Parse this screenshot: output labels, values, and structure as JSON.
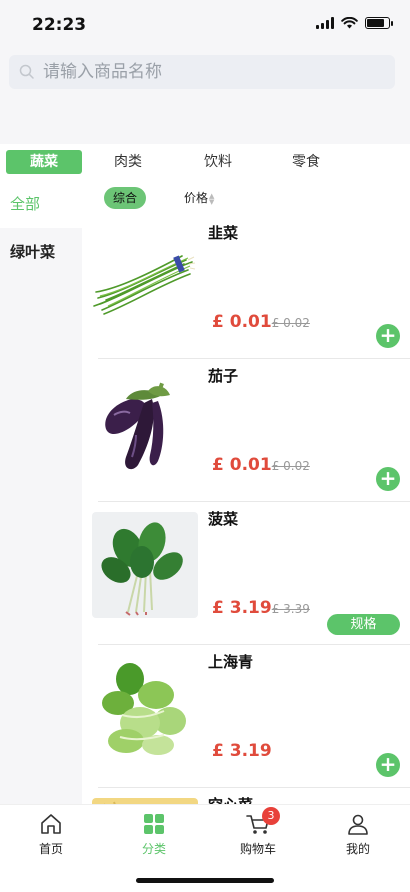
{
  "status_bar": {
    "time": "22:23",
    "battery_level": 0.8
  },
  "search": {
    "placeholder": "请输入商品名称",
    "value": ""
  },
  "top_categories": [
    {
      "label": "蔬菜",
      "active": true
    },
    {
      "label": "肉类",
      "active": false
    },
    {
      "label": "饮料",
      "active": false
    },
    {
      "label": "零食",
      "active": false
    }
  ],
  "sidebar": {
    "items": [
      {
        "label": "全部",
        "active": true
      },
      {
        "label": "绿叶菜",
        "active": false
      }
    ]
  },
  "sort": {
    "composite_label": "综合",
    "price_label": "价格"
  },
  "products": [
    {
      "name": "韭菜",
      "price": "£ 0.01",
      "old_price": "£ 0.02",
      "action": "add",
      "image": "chives"
    },
    {
      "name": "茄子",
      "price": "£ 0.01",
      "old_price": "£ 0.02",
      "action": "add",
      "image": "eggplant"
    },
    {
      "name": "菠菜",
      "price": "£ 3.19",
      "old_price": "£ 3.39",
      "action": "spec",
      "action_label": "规格",
      "image": "spinach"
    },
    {
      "name": "上海青",
      "price": "£ 3.19",
      "old_price": "",
      "action": "add",
      "image": "bok-choy"
    },
    {
      "name": "空心菜",
      "price": "",
      "old_price": "",
      "action": "",
      "image": "water-spinach"
    }
  ],
  "tab_bar": {
    "tabs": [
      {
        "label": "首页",
        "icon": "home-icon",
        "active": false
      },
      {
        "label": "分类",
        "icon": "category-icon",
        "active": true
      },
      {
        "label": "购物车",
        "icon": "cart-icon",
        "active": false
      },
      {
        "label": "我的",
        "icon": "user-icon",
        "active": false
      }
    ],
    "cart_badge": "3"
  },
  "colors": {
    "accent": "#5cc46a",
    "price": "#e04b3c",
    "badge": "#e8413a"
  }
}
